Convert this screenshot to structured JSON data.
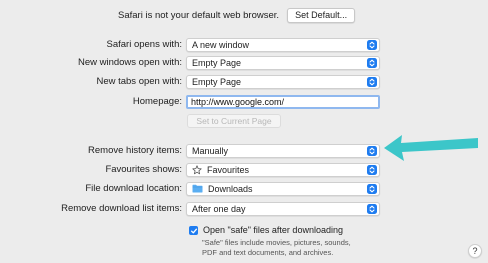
{
  "notice": {
    "text": "Safari is not your default web browser.",
    "set_default_label": "Set Default..."
  },
  "settings": {
    "opens_with": {
      "label": "Safari opens with:",
      "value": "A new window"
    },
    "new_windows": {
      "label": "New windows open with:",
      "value": "Empty Page"
    },
    "new_tabs": {
      "label": "New tabs open with:",
      "value": "Empty Page"
    },
    "homepage": {
      "label": "Homepage:",
      "value": "http://www.google.com/"
    },
    "set_current_label": "Set to Current Page",
    "remove_history": {
      "label": "Remove history items:",
      "value": "Manually"
    },
    "favourites_shows": {
      "label": "Favourites shows:",
      "value": "Favourites",
      "icon": "star-icon"
    },
    "download_location": {
      "label": "File download location:",
      "value": "Downloads",
      "icon": "folder-icon"
    },
    "remove_download_list": {
      "label": "Remove download list items:",
      "value": "After one day"
    }
  },
  "open_safe": {
    "label": "Open \"safe\" files after downloading",
    "checked": true,
    "help_line1": "\"Safe\" files include movies, pictures, sounds,",
    "help_line2": "PDF and text documents, and archives."
  },
  "help_button_label": "?",
  "colors": {
    "accent": "#1e7cf0",
    "arrow": "#3cc6c9",
    "background": "#ececec"
  }
}
